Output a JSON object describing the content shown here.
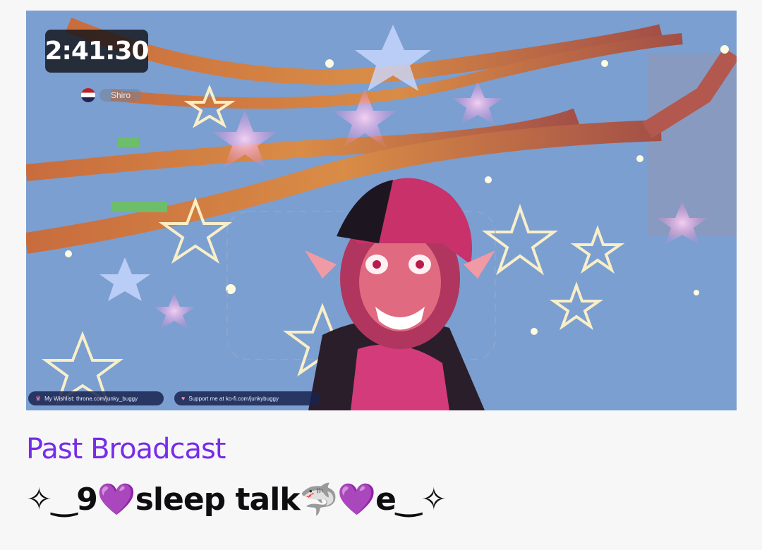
{
  "video": {
    "duration": "2:41:30",
    "in_stream_nameplate": "Shiro",
    "overlay_left": "My Wishlist: throne.com/junky_buggy",
    "overlay_right": "Support me at ko-fi.com/junkybuggy"
  },
  "broadcast": {
    "label": "Past Broadcast",
    "title": "✧‿9💜sleep talk🦈💜e‿✧"
  },
  "colors": {
    "label_purple": "#772ce8",
    "page_background": "#f7f7f8",
    "title_text": "#0e0e10"
  }
}
